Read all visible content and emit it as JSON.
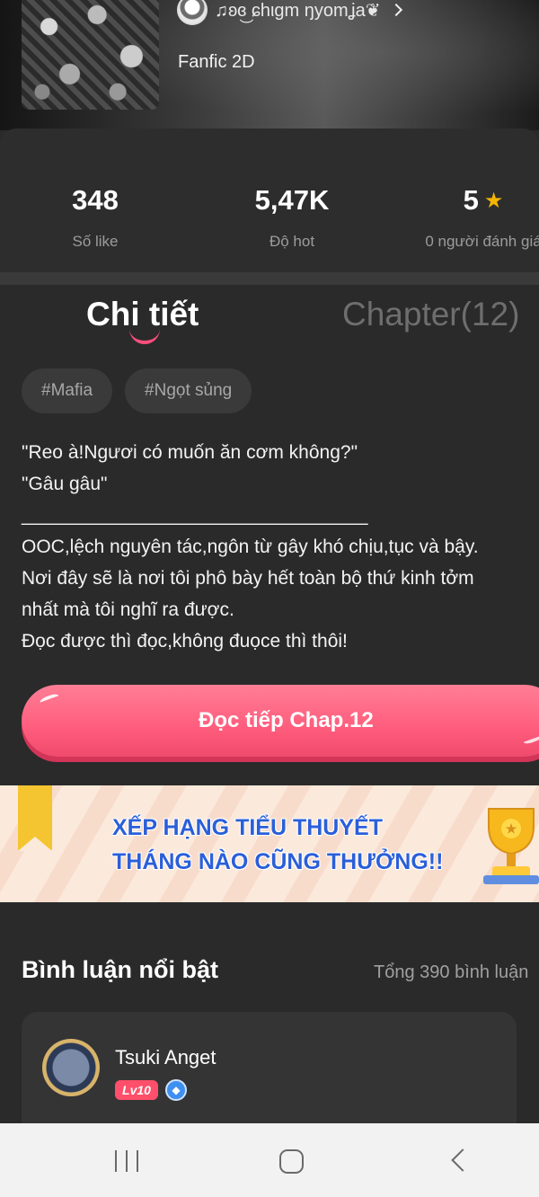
{
  "header": {
    "author_name": "♫ʚɞ͜ ɕhιgm ŋyomʝa❦",
    "category": "Fanfic 2D"
  },
  "stats": [
    {
      "value": "348",
      "label": "Số like"
    },
    {
      "value": "5,47K",
      "label": "Độ hot"
    },
    {
      "value": "5",
      "label": "0 người đánh giá"
    }
  ],
  "tabs": {
    "detail": "Chi tiết",
    "chapters": "Chapter(12)"
  },
  "tags": [
    "#Mafia",
    "#Ngọt sủng"
  ],
  "description": [
    "\"Reo à!Ngươi có muốn ăn cơm không?\"",
    "\"Gâu gâu\"",
    "_________________________________",
    "OOC,lệch nguyên tác,ngôn từ gây khó chịu,tục và bậy.",
    "Nơi đây sẽ là nơi tôi phô bày hết toàn bộ thứ kinh tởm",
    "nhất mà tôi nghĩ ra được.",
    "Đọc được thì đọc,không đuọce thì thôi!"
  ],
  "read_button": "Đọc tiếp Chap.12",
  "banner": {
    "line1": "XẾP HẠNG TIỂU THUYẾT",
    "line2": "THÁNG NÀO CŨNG THƯỞNG!!"
  },
  "comments": {
    "title": "Bình luận nổi bật",
    "total": "Tổng 390 bình luận",
    "first": {
      "name": "Tsuki Anget",
      "level": "Lv10"
    }
  },
  "icons": {
    "star": "star-icon",
    "chevron": "chevron-right-icon",
    "verify": "verified-icon"
  },
  "colors": {
    "accent": "#ff5d7d",
    "banner_text": "#2b5fd9",
    "star": "#f5b400"
  }
}
